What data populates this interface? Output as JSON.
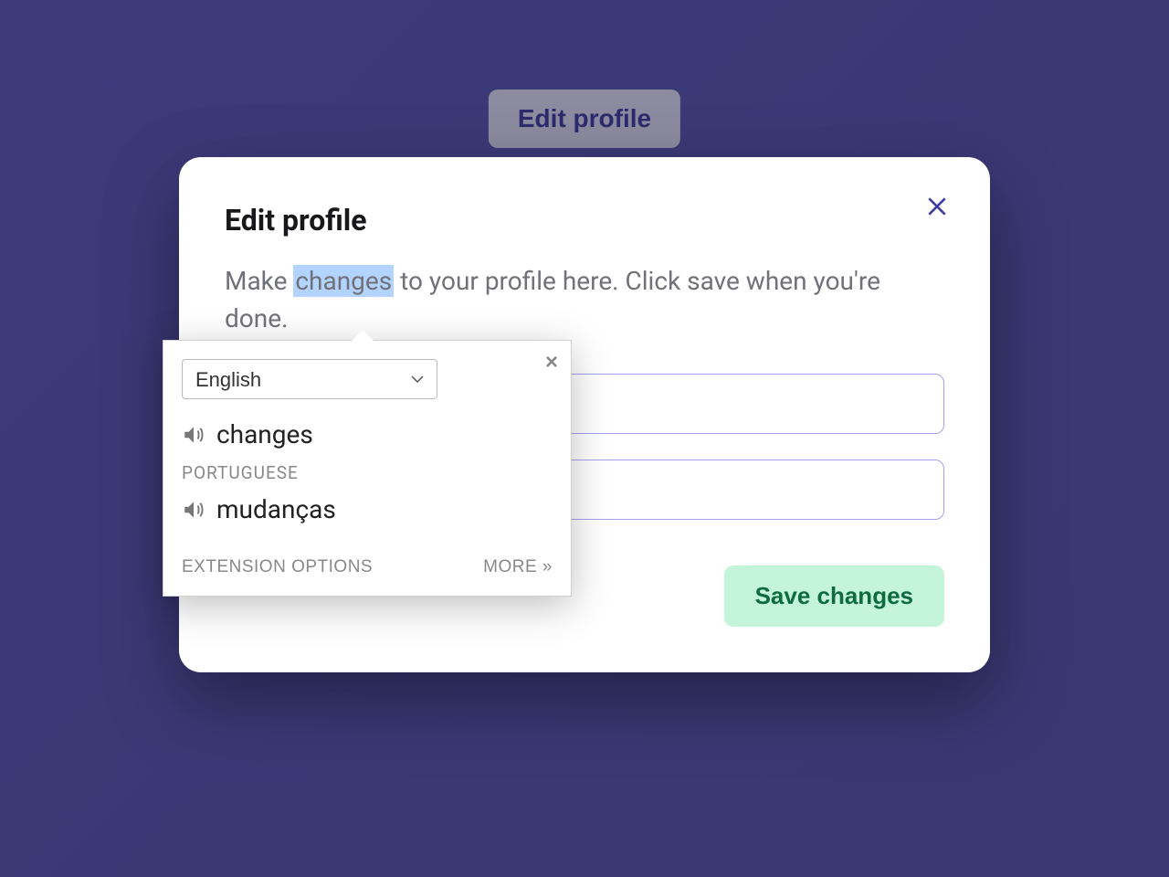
{
  "trigger": {
    "label": "Edit profile"
  },
  "dialog": {
    "title": "Edit profile",
    "description_prefix": "Make ",
    "description_highlighted": "changes",
    "description_suffix": " to your profile here. Click save when you're done.",
    "save_label": "Save changes"
  },
  "translate_popup": {
    "language_selected": "English",
    "source_word": "changes",
    "target_label": "PORTUGUESE",
    "target_word": "mudanças",
    "extension_options": "EXTENSION OPTIONS",
    "more": "MORE »"
  }
}
